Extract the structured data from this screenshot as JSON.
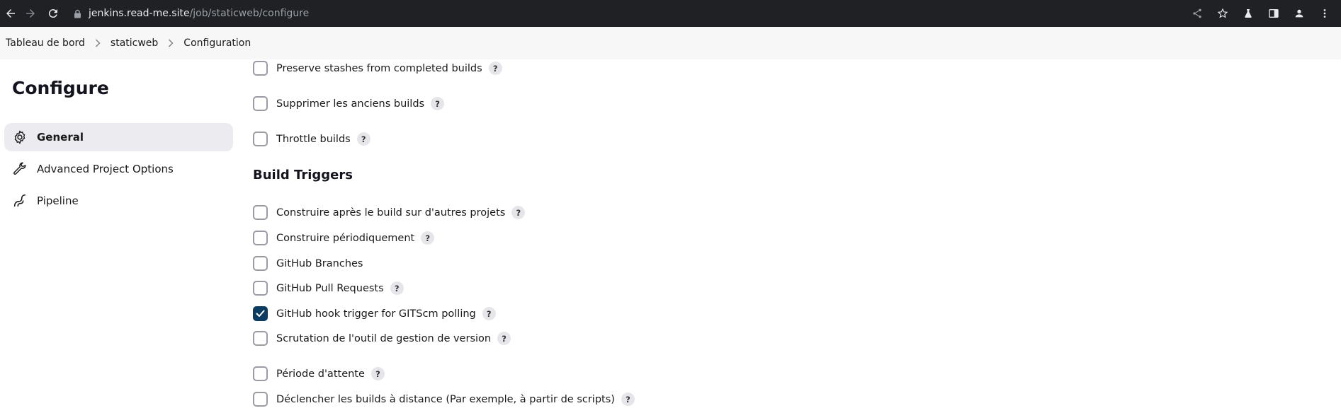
{
  "browser": {
    "url_host": "jenkins.read-me.site",
    "url_path": "/job/staticweb/configure"
  },
  "breadcrumb": [
    {
      "label": "Tableau de bord"
    },
    {
      "label": "staticweb"
    },
    {
      "label": "Configuration"
    }
  ],
  "sidebar": {
    "title": "Configure",
    "items": [
      {
        "label": "General",
        "icon": "gear-icon",
        "active": true
      },
      {
        "label": "Advanced Project Options",
        "icon": "wrench-icon",
        "active": false
      },
      {
        "label": "Pipeline",
        "icon": "pipeline-icon",
        "active": false
      }
    ]
  },
  "general_options": [
    {
      "label": "Preserve stashes from completed builds",
      "checked": false,
      "help": "?"
    },
    {
      "label": "Supprimer les anciens builds",
      "checked": false,
      "help": "?"
    },
    {
      "label": "Throttle builds",
      "checked": false,
      "help": "?"
    }
  ],
  "build_triggers": {
    "title": "Build Triggers",
    "options": [
      {
        "label": "Construire après le build sur d'autres projets",
        "checked": false,
        "help": "?"
      },
      {
        "label": "Construire périodiquement",
        "checked": false,
        "help": "?"
      },
      {
        "label": "GitHub Branches",
        "checked": false,
        "help": ""
      },
      {
        "label": "GitHub Pull Requests",
        "checked": false,
        "help": "?"
      },
      {
        "label": "GitHub hook trigger for GITScm polling",
        "checked": true,
        "help": "?"
      },
      {
        "label": "Scrutation de l'outil de gestion de version",
        "checked": false,
        "help": "?"
      },
      {
        "label": "Période d'attente",
        "checked": false,
        "help": "?"
      },
      {
        "label": "Déclencher les builds à distance (Par exemple, à partir de scripts)",
        "checked": false,
        "help": "?"
      }
    ]
  },
  "colors": {
    "checkbox_checked": "#0b3d62",
    "sidebar_active": "#ececf0",
    "chrome_bg": "#202124"
  }
}
